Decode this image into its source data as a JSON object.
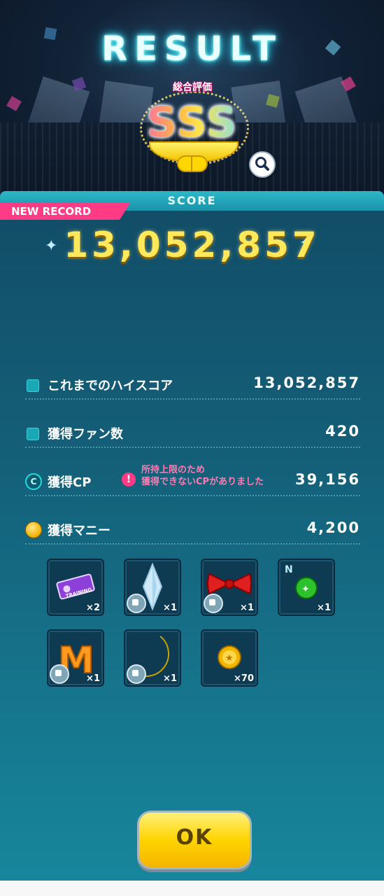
{
  "header": {
    "title": "RESULT",
    "rank_label": "総合評価",
    "rank": "SSS"
  },
  "score": {
    "section_label": "SCORE",
    "new_record_label": "NEW RECORD",
    "value": "13,052,857"
  },
  "stats": [
    {
      "label": "これまでのハイスコア",
      "value": "13,052,857",
      "icon": "square-bullet-icon"
    },
    {
      "label": "獲得ファン数",
      "value": "420",
      "icon": "square-bullet-icon"
    },
    {
      "label": "獲得CP",
      "value": "39,156",
      "icon": "cp-coin-icon",
      "icon_text": "C",
      "warning_line1": "所持上限のため",
      "warning_line2": "獲得できないCPがありました"
    },
    {
      "label": "獲得マニー",
      "value": "4,200",
      "icon": "money-coin-icon"
    }
  ],
  "rewards": [
    {
      "name": "training-ticket",
      "qty": "×2",
      "ticket_text": "TRAINING",
      "badge": false
    },
    {
      "name": "crystal-item",
      "qty": "×1",
      "badge": true
    },
    {
      "name": "red-bow-item",
      "qty": "×1",
      "badge": true
    },
    {
      "name": "green-gem-item",
      "qty": "×1",
      "badge": false,
      "corner_label": "N"
    },
    {
      "name": "letter-m-item",
      "qty": "×1",
      "badge": true,
      "letter": "M"
    },
    {
      "name": "crescent-moon-item",
      "qty": "×1",
      "badge": true
    },
    {
      "name": "gold-coin-item",
      "qty": "×70",
      "badge": false
    }
  ],
  "ok_button": {
    "label": "OK"
  },
  "colors": {
    "accent_pink": "#ff3b86",
    "score_yellow": "#ffe95a",
    "panel_teal": "#146079",
    "ok_yellow": "#ffd400"
  }
}
